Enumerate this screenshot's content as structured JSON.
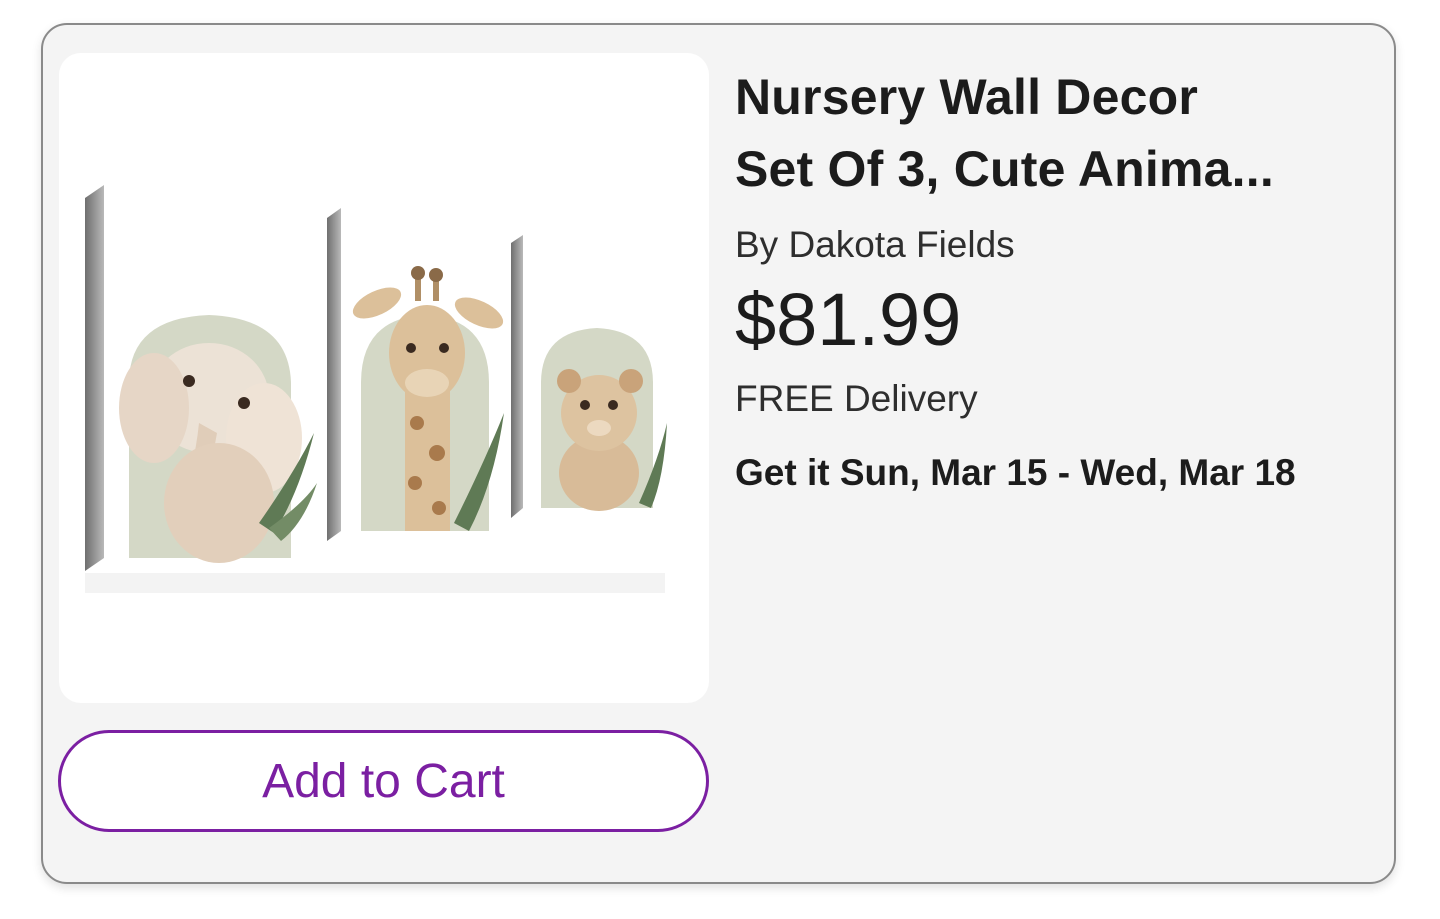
{
  "product": {
    "title_line1": "Nursery Wall Decor",
    "title_line2": "Set Of 3, Cute Anima...",
    "brand": "By Dakota Fields",
    "price": "$81.99",
    "delivery": "FREE Delivery",
    "eta": "Get it Sun, Mar 15 - Wed, Mar 18",
    "image_icon": "canvas-art-elephant-giraffe-lion"
  },
  "actions": {
    "add_to_cart_label": "Add to Cart"
  },
  "colors": {
    "accent": "#7b1fa2",
    "card_bg": "#f4f4f4",
    "border": "#8a8a8a"
  }
}
